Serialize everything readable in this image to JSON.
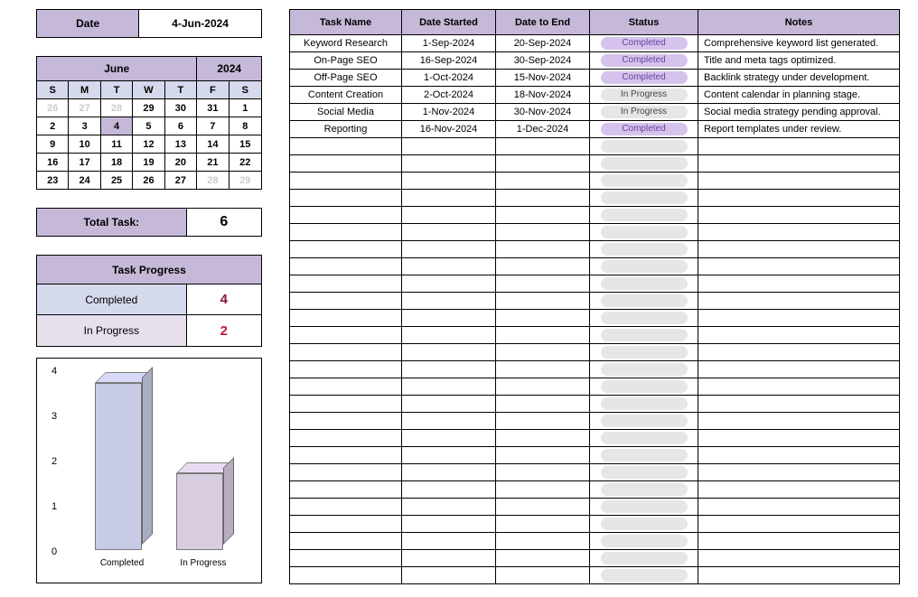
{
  "date": {
    "label": "Date",
    "value": "4-Jun-2024"
  },
  "calendar": {
    "month": "June",
    "year": "2024",
    "dow": [
      "S",
      "M",
      "T",
      "W",
      "T",
      "F",
      "S"
    ],
    "cells": [
      {
        "n": "26",
        "dim": true
      },
      {
        "n": "27",
        "dim": true
      },
      {
        "n": "28",
        "dim": true
      },
      {
        "n": "29"
      },
      {
        "n": "30"
      },
      {
        "n": "31"
      },
      {
        "n": "1"
      },
      {
        "n": "2"
      },
      {
        "n": "3"
      },
      {
        "n": "4",
        "today": true
      },
      {
        "n": "5"
      },
      {
        "n": "6"
      },
      {
        "n": "7"
      },
      {
        "n": "8"
      },
      {
        "n": "9"
      },
      {
        "n": "10"
      },
      {
        "n": "11"
      },
      {
        "n": "12"
      },
      {
        "n": "13"
      },
      {
        "n": "14"
      },
      {
        "n": "15"
      },
      {
        "n": "16"
      },
      {
        "n": "17"
      },
      {
        "n": "18"
      },
      {
        "n": "19"
      },
      {
        "n": "20"
      },
      {
        "n": "21"
      },
      {
        "n": "22"
      },
      {
        "n": "23"
      },
      {
        "n": "24"
      },
      {
        "n": "25"
      },
      {
        "n": "26"
      },
      {
        "n": "27"
      },
      {
        "n": "28",
        "dim": true
      },
      {
        "n": "29",
        "dim": true
      }
    ]
  },
  "total_task": {
    "label": "Total Task:",
    "value": "6"
  },
  "progress": {
    "title": "Task Progress",
    "rows": [
      {
        "label": "Completed",
        "value": "4",
        "cls": "completed"
      },
      {
        "label": "In Progress",
        "value": "2",
        "cls": "inprogress"
      }
    ]
  },
  "chart_data": {
    "type": "bar",
    "categories": [
      "Completed",
      "In Progress"
    ],
    "values": [
      3.7,
      1.7
    ],
    "ylim": [
      0,
      4
    ],
    "yticks": [
      0,
      1,
      2,
      3,
      4
    ],
    "colors": [
      "#c7cbe6",
      "#d8cce0"
    ]
  },
  "table": {
    "headers": [
      "Task Name",
      "Date Started",
      "Date to End",
      "Status",
      "Notes"
    ],
    "rows": [
      {
        "name": "Keyword Research",
        "start": "1-Sep-2024",
        "end": "20-Sep-2024",
        "status": "Completed",
        "status_cls": "completed",
        "notes": "Comprehensive keyword list generated."
      },
      {
        "name": "On-Page SEO",
        "start": "16-Sep-2024",
        "end": "30-Sep-2024",
        "status": "Completed",
        "status_cls": "completed",
        "notes": "Title and meta tags optimized."
      },
      {
        "name": "Off-Page SEO",
        "start": "1-Oct-2024",
        "end": "15-Nov-2024",
        "status": "Completed",
        "status_cls": "completed",
        "notes": "Backlink strategy under development."
      },
      {
        "name": "Content Creation",
        "start": "2-Oct-2024",
        "end": "18-Nov-2024",
        "status": "In Progress",
        "status_cls": "inprogress",
        "notes": "Content calendar in planning stage."
      },
      {
        "name": "Social Media",
        "start": "1-Nov-2024",
        "end": "30-Nov-2024",
        "status": "In Progress",
        "status_cls": "inprogress",
        "notes": "Social media strategy pending approval."
      },
      {
        "name": "Reporting",
        "start": "16-Nov-2024",
        "end": "1-Dec-2024",
        "status": "Completed",
        "status_cls": "completed",
        "notes": "Report templates under review."
      }
    ],
    "empty_rows": 26
  }
}
